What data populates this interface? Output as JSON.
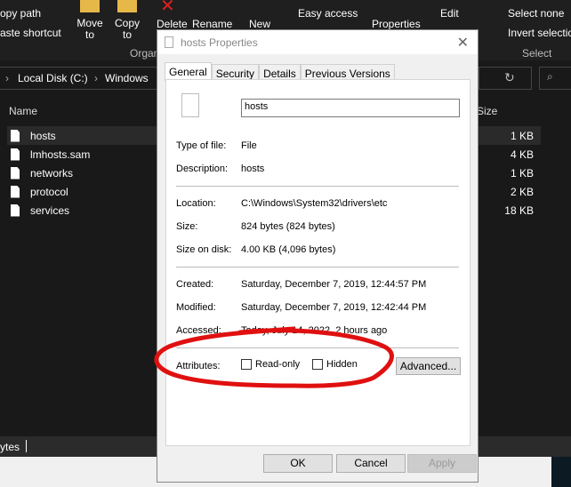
{
  "ribbon": {
    "copy_path": "opy path",
    "paste_shortcut": "aste shortcut",
    "move_to": "Move to",
    "copy_to": "Copy to",
    "delete": "Delete",
    "rename": "Rename",
    "new": "New",
    "easy_access": "Easy access",
    "properties": "Properties",
    "edit": "Edit",
    "select_none": "Select none",
    "invert_selection": "Invert selection",
    "group_organize": "Organ",
    "group_select": "Select"
  },
  "address": {
    "crumbs": [
      "Local Disk (C:)",
      "Windows"
    ]
  },
  "list": {
    "col_name": "Name",
    "col_size": "Size",
    "files": [
      {
        "name": "hosts",
        "size": "1 KB"
      },
      {
        "name": "lmhosts.sam",
        "size": "4 KB"
      },
      {
        "name": "networks",
        "size": "1 KB"
      },
      {
        "name": "protocol",
        "size": "2 KB"
      },
      {
        "name": "services",
        "size": "18 KB"
      }
    ]
  },
  "status": {
    "text": "ytes"
  },
  "dialog": {
    "title": "hosts Properties",
    "tabs": [
      "General",
      "Security",
      "Details",
      "Previous Versions"
    ],
    "filename": "hosts",
    "type_label": "Type of file:",
    "type": "File",
    "desc_label": "Description:",
    "desc": "hosts",
    "loc_label": "Location:",
    "loc": "C:\\Windows\\System32\\drivers\\etc",
    "size_label": "Size:",
    "size": "824 bytes (824 bytes)",
    "disk_label": "Size on disk:",
    "disk": "4.00 KB (4,096 bytes)",
    "created_label": "Created:",
    "created": "Saturday, December 7, 2019, 12:44:57 PM",
    "modified_label": "Modified:",
    "modified": "Saturday, December 7, 2019, 12:42:44 PM",
    "accessed_label": "Accessed:",
    "accessed": "Today, July 14, 2022, 2 hours ago",
    "attr_label": "Attributes:",
    "readonly": "Read-only",
    "hidden": "Hidden",
    "advanced": "Advanced...",
    "ok": "OK",
    "cancel": "Cancel",
    "apply": "Apply"
  },
  "annotation_color": "#e01010"
}
